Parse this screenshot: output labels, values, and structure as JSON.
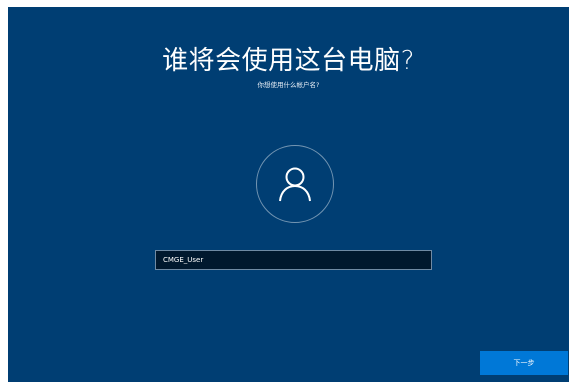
{
  "setup": {
    "title": "谁将会使用这台电脑?",
    "subtitle": "你想使用什么帐户名?",
    "avatar_icon": "user-icon",
    "username_value": "CMGE_User",
    "next_label": "下一步"
  },
  "colors": {
    "background": "#003e73",
    "input_background": "#00182e",
    "button": "#0078d7",
    "text": "#ffffff"
  }
}
